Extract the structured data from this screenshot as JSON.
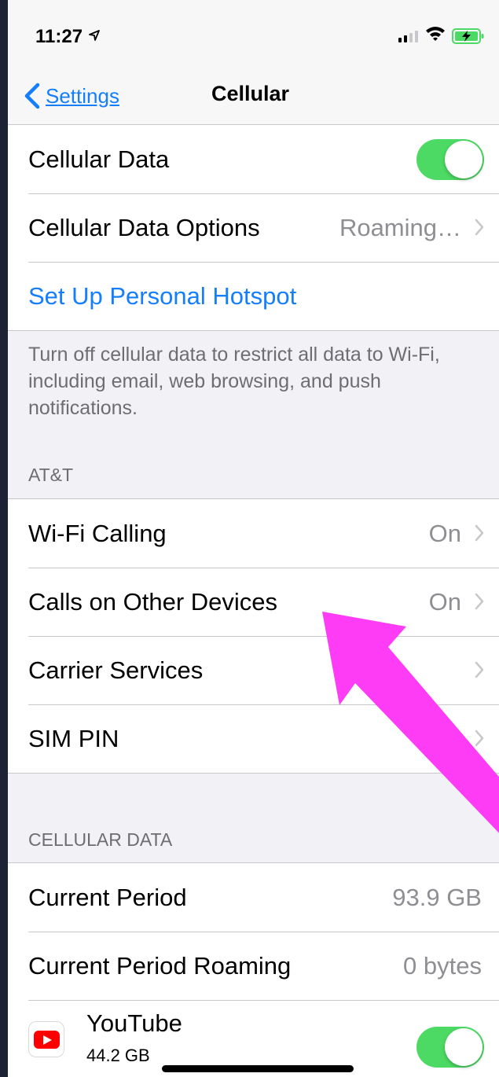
{
  "status_bar": {
    "time": "11:27",
    "location_icon": "location-arrow-icon",
    "signal_bars": 2,
    "battery": "charging"
  },
  "nav": {
    "back_label": "Settings",
    "title": "Cellular"
  },
  "group1": {
    "cellular_data": {
      "label": "Cellular Data",
      "toggle_on": true
    },
    "cellular_data_options": {
      "label": "Cellular Data Options",
      "value": "Roaming…"
    },
    "hotspot": {
      "label": "Set Up Personal Hotspot"
    }
  },
  "footnote": "Turn off cellular data to restrict all data to Wi-Fi, including email, web browsing, and push notifications.",
  "carrier_header": "AT&T",
  "group2": {
    "wifi_calling": {
      "label": "Wi-Fi Calling",
      "value": "On"
    },
    "calls_other": {
      "label": "Calls on Other Devices",
      "value": "On"
    },
    "carrier_services": {
      "label": "Carrier Services"
    },
    "sim_pin": {
      "label": "SIM PIN"
    }
  },
  "cellular_data_header": "CELLULAR DATA",
  "group3": {
    "current_period": {
      "label": "Current Period",
      "value": "93.9 GB"
    },
    "current_period_roaming": {
      "label": "Current Period Roaming",
      "value": "0 bytes"
    },
    "youtube": {
      "name": "YouTube",
      "size": "44.2 GB",
      "toggle_on": true
    }
  },
  "colors": {
    "accent": "#147efb",
    "toggle_on": "#4cd964",
    "annotation_arrow": "#ff3cf5",
    "background": "#f2f1f6"
  }
}
